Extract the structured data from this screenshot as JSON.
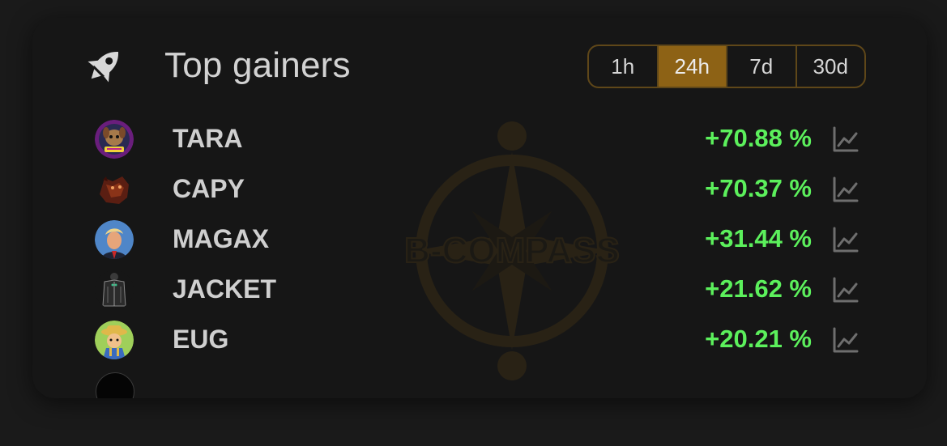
{
  "header": {
    "title": "Top gainers",
    "icon": "rocket-icon"
  },
  "watermark": {
    "text": "B-COMPASS",
    "color": "#8d6215"
  },
  "tabs": [
    {
      "label": "1h",
      "active": false
    },
    {
      "label": "24h",
      "active": true
    },
    {
      "label": "7d",
      "active": false
    },
    {
      "label": "30d",
      "active": false
    }
  ],
  "gainers": [
    {
      "ticker": "TARA",
      "change": "+70.88 %",
      "avatar": "tara-avatar"
    },
    {
      "ticker": "CAPY",
      "change": "+70.37 %",
      "avatar": "capy-avatar"
    },
    {
      "ticker": "MAGAX",
      "change": "+31.44 %",
      "avatar": "magax-avatar"
    },
    {
      "ticker": "JACKET",
      "change": "+21.62 %",
      "avatar": "jacket-avatar"
    },
    {
      "ticker": "EUG",
      "change": "+20.21 %",
      "avatar": "eug-avatar"
    }
  ],
  "colors": {
    "positive": "#5cf05c",
    "accent": "#8d6215",
    "accent_border": "#5f4719",
    "card_bg": "#161616",
    "page_bg": "#1a1a1a"
  }
}
